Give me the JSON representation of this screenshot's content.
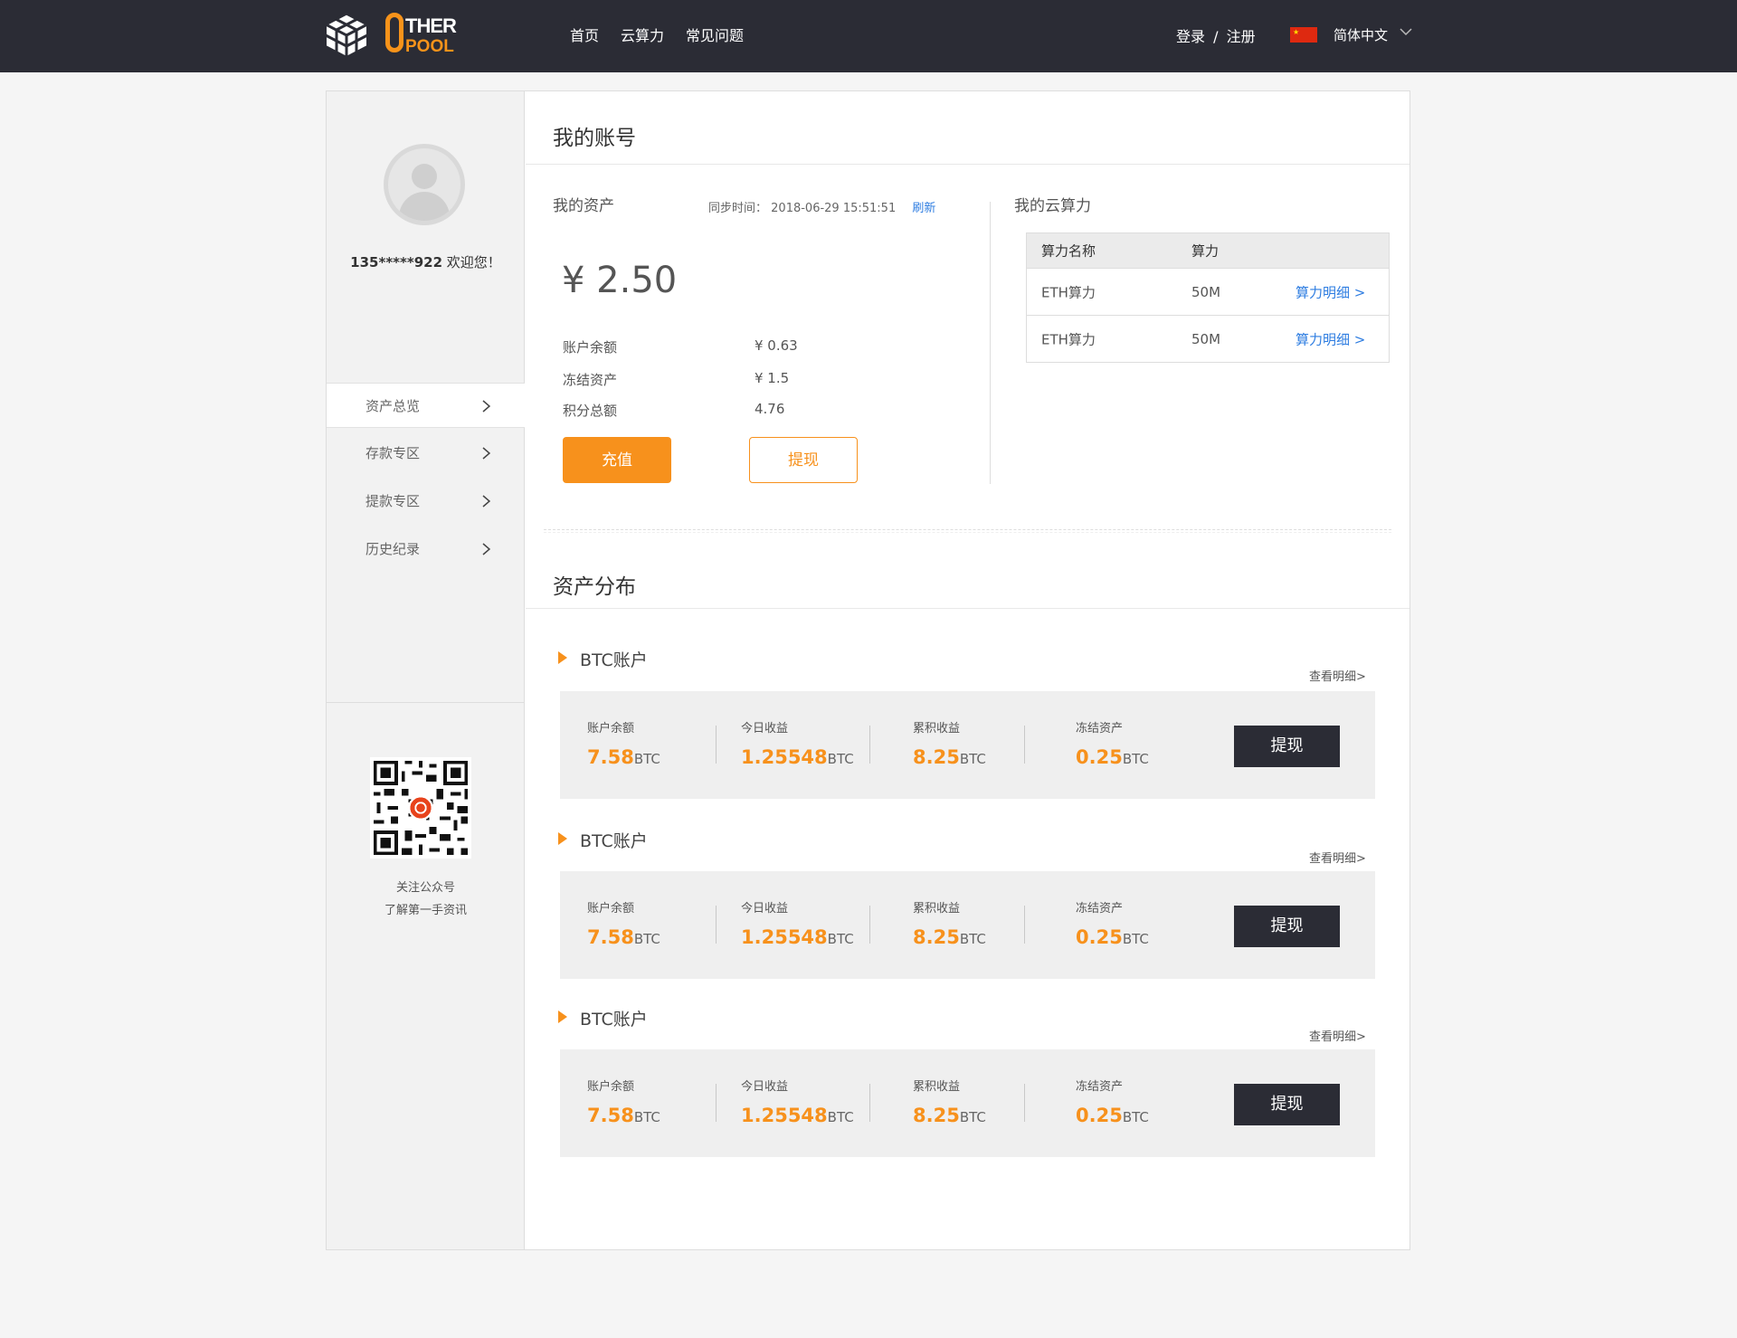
{
  "header": {
    "logo_top": "THER",
    "logo_bottom": "POOL",
    "nav": [
      "首页",
      "云算力",
      "常见问题"
    ],
    "login": "登录",
    "separator": "/",
    "register": "注册",
    "language": "简体中文"
  },
  "sidebar": {
    "user": "135*****922",
    "welcome": "欢迎您！",
    "menu": [
      {
        "label": "资产总览",
        "active": true
      },
      {
        "label": "存款专区",
        "active": false
      },
      {
        "label": "提款专区",
        "active": false
      },
      {
        "label": "历史纪录",
        "active": false
      }
    ],
    "qr_caption_1": "关注公众号",
    "qr_caption_2": "了解第一手资讯"
  },
  "account": {
    "title": "我的账号",
    "assets_label": "我的资产",
    "sync_label": "同步时间：",
    "sync_time": "2018-06-29 15:51:51",
    "refresh": "刷新",
    "total": "¥ 2.50",
    "rows": [
      {
        "label": "账户余额",
        "value": "¥ 0.63"
      },
      {
        "label": "冻结资产",
        "value": "¥ 1.5"
      },
      {
        "label": "积分总额",
        "value": "4.76"
      }
    ],
    "recharge": "充值",
    "withdraw": "提现"
  },
  "cloud": {
    "title": "我的云算力",
    "headers": [
      "算力名称",
      "算力"
    ],
    "rows": [
      {
        "name": "ETH算力",
        "power": "50M",
        "link": "算力明细 >"
      },
      {
        "name": "ETH算力",
        "power": "50M",
        "link": "算力明细 >"
      }
    ]
  },
  "distribution": {
    "title": "资产分布",
    "accounts": [
      {
        "name": "BTC账户",
        "detail": "查看明细>",
        "stats": [
          {
            "label": "账户余额",
            "value": "7.58",
            "unit": "BTC"
          },
          {
            "label": "今日收益",
            "value": "1.25548",
            "unit": "BTC"
          },
          {
            "label": "累积收益",
            "value": "8.25",
            "unit": "BTC"
          },
          {
            "label": "冻结资产",
            "value": "0.25",
            "unit": "BTC"
          }
        ],
        "action": "提现"
      },
      {
        "name": "BTC账户",
        "detail": "查看明细>",
        "stats": [
          {
            "label": "账户余额",
            "value": "7.58",
            "unit": "BTC"
          },
          {
            "label": "今日收益",
            "value": "1.25548",
            "unit": "BTC"
          },
          {
            "label": "累积收益",
            "value": "8.25",
            "unit": "BTC"
          },
          {
            "label": "冻结资产",
            "value": "0.25",
            "unit": "BTC"
          }
        ],
        "action": "提现"
      },
      {
        "name": "BTC账户",
        "detail": "查看明细>",
        "stats": [
          {
            "label": "账户余额",
            "value": "7.58",
            "unit": "BTC"
          },
          {
            "label": "今日收益",
            "value": "1.25548",
            "unit": "BTC"
          },
          {
            "label": "累积收益",
            "value": "8.25",
            "unit": "BTC"
          },
          {
            "label": "冻结资产",
            "value": "0.25",
            "unit": "BTC"
          }
        ],
        "action": "提现"
      }
    ]
  },
  "colors": {
    "accent": "#f7911c",
    "dark": "#2b2c35",
    "link": "#2e7de1"
  }
}
